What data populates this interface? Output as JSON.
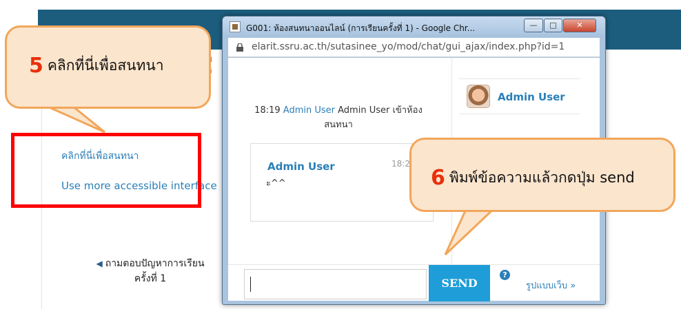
{
  "background_page": {
    "snippet_lines": [
      "ผ",
      "จิ"
    ],
    "chat_link": "คลิกที่นี่เพื่อสนทนา",
    "accessible_link": "Use more accessible interface",
    "prev_arrow": "◀",
    "prev_line1": "ถามตอบปัญหาการเรียน",
    "prev_line2": "ครั้งที่ 1"
  },
  "callouts": {
    "step5": {
      "number": "5",
      "text": "คลิกที่นี่เพื่อสนทนา"
    },
    "step6": {
      "number": "6",
      "text": "พิมพ์ข้อความแล้วกดปุ่ม send"
    }
  },
  "window": {
    "title": "G001: ห้องสนทนาออนไลน์ (การเรียนครั้งที่ 1) - Google Chr...",
    "minimize": "—",
    "maximize": "□",
    "close": "✕",
    "url": "elarit.ssru.ac.th/sutasinee_yo/mod/chat/gui_ajax/index.php?id=1"
  },
  "chat": {
    "system_time": "18:19",
    "system_user": "Admin User",
    "system_text": "Admin User เข้าห้องสนทนา",
    "message": {
      "sender": "Admin User",
      "time": "18:20",
      "text": "ะ^^"
    }
  },
  "users": [
    {
      "name": "Admin User"
    }
  ],
  "input": {
    "value": ""
  },
  "send_label": "SEND",
  "help_label": "?",
  "web_link": "รูปแบบเว็บ »",
  "colors": {
    "callout_fill": "#fbe5cd",
    "callout_border": "#f2a65a",
    "step_number": "#e8300b",
    "highlight_box": "#ff0000",
    "send_button": "#1e9dd8",
    "link": "#2a7fb8"
  }
}
